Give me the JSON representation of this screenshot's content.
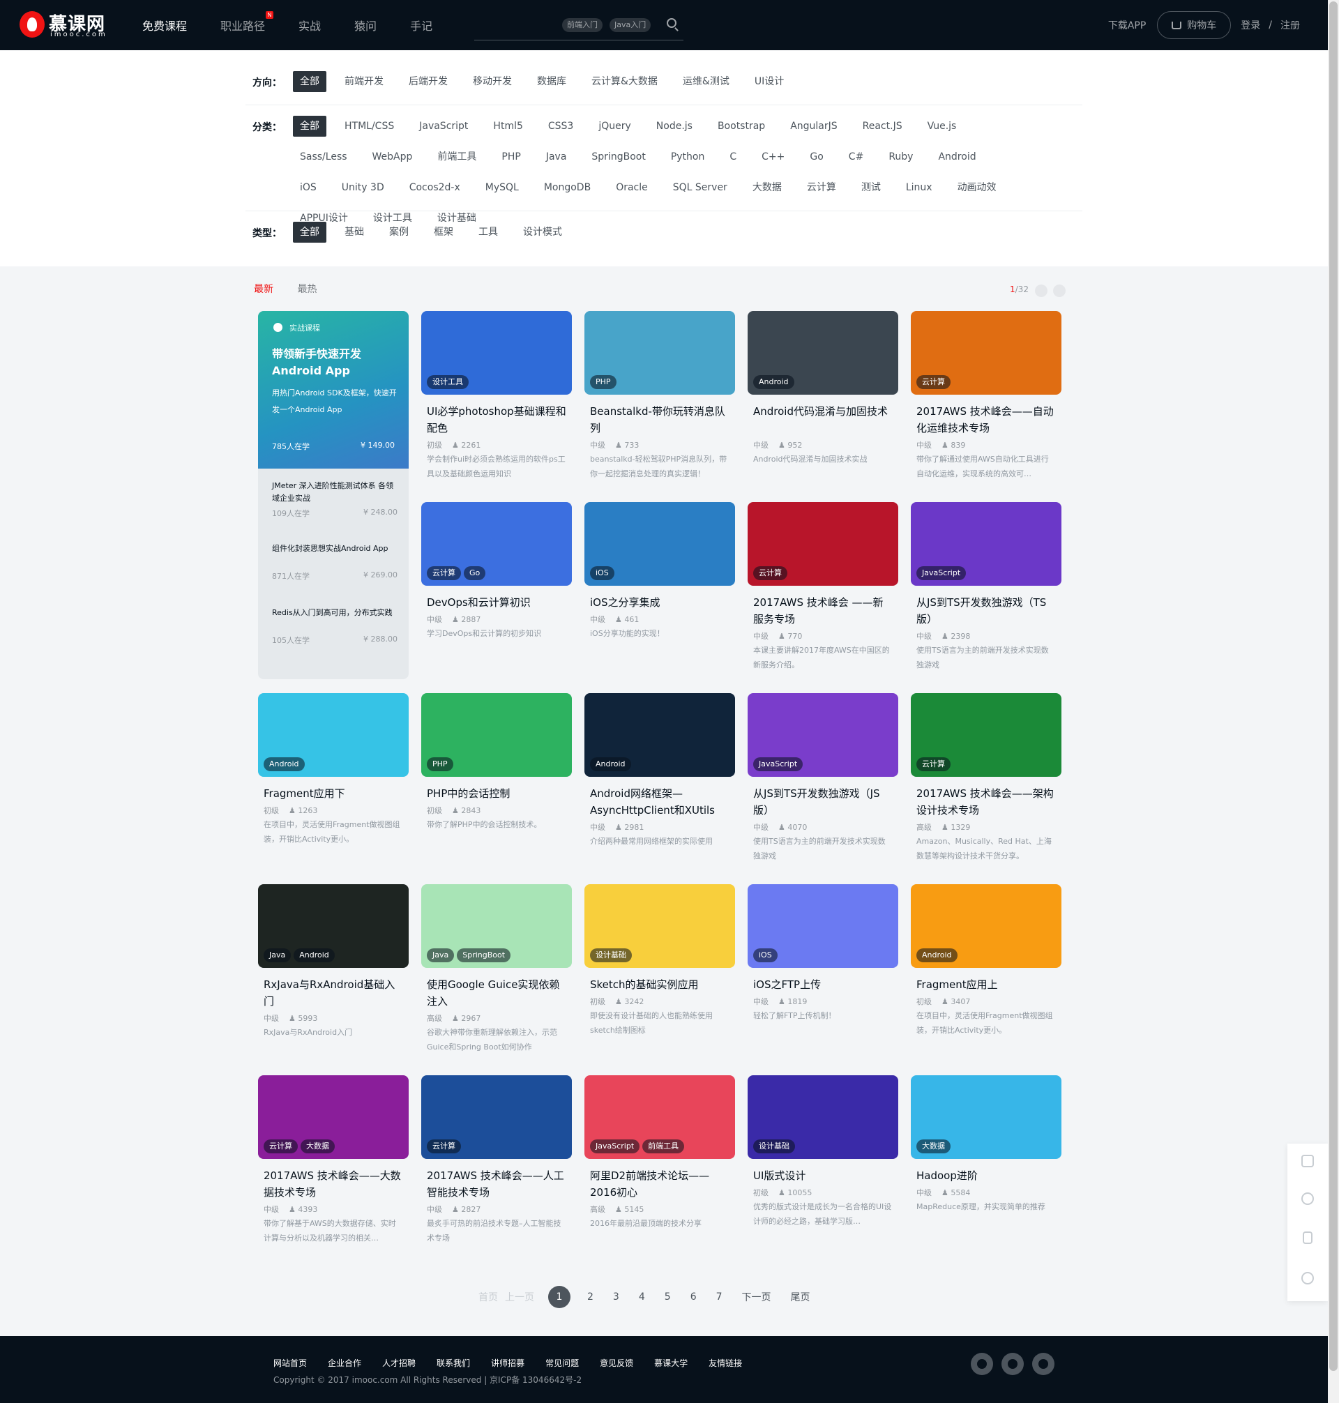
{
  "header": {
    "logo_cn": "慕课网",
    "logo_en": "imooc.com",
    "nav": [
      {
        "label": "免费课程",
        "active": true
      },
      {
        "label": "职业路径",
        "badge": "N"
      },
      {
        "label": "实战"
      },
      {
        "label": "猿问"
      },
      {
        "label": "手记"
      }
    ],
    "search_tags": [
      "前端入门",
      "Java入门"
    ],
    "download": "下载APP",
    "cart": "购物车",
    "login": "登录",
    "sep": "/",
    "register": "注册"
  },
  "filters": {
    "direction": {
      "label": "方向：",
      "items": [
        "全部",
        "前端开发",
        "后端开发",
        "移动开发",
        "数据库",
        "云计算&大数据",
        "运维&测试",
        "UI设计"
      ]
    },
    "category": {
      "label": "分类：",
      "items": [
        "全部",
        "HTML/CSS",
        "JavaScript",
        "Html5",
        "CSS3",
        "jQuery",
        "Node.js",
        "Bootstrap",
        "AngularJS",
        "React.JS",
        "Vue.js",
        "Sass/Less",
        "WebApp",
        "前端工具",
        "PHP",
        "Java",
        "SpringBoot",
        "Python",
        "C",
        "C++",
        "Go",
        "C#",
        "Ruby",
        "Android",
        "iOS",
        "Unity 3D",
        "Cocos2d-x",
        "MySQL",
        "MongoDB",
        "Oracle",
        "SQL Server",
        "大数据",
        "云计算",
        "测试",
        "Linux",
        "动画动效",
        "APPUI设计",
        "设计工具",
        "设计基础"
      ]
    },
    "type": {
      "label": "类型：",
      "items": [
        "全部",
        "基础",
        "案例",
        "框架",
        "工具",
        "设计模式"
      ]
    }
  },
  "sort": {
    "newest": "最新",
    "hottest": "最热"
  },
  "page_info": {
    "current": "1",
    "total": "/32"
  },
  "feature": {
    "tag": "实战课程",
    "title": "带领新手快速开发Android App",
    "desc": "用热门Android SDK及框架，快速开发一个Android App",
    "students": "785人在学",
    "price": "¥ 149.00",
    "list": [
      {
        "title": "JMeter 深入进阶性能测试体系 各领域企业实战",
        "students": "109人在学",
        "price": "¥ 248.00"
      },
      {
        "title": "组件化封装思想实战Android App",
        "students": "871人在学",
        "price": "¥ 269.00"
      },
      {
        "title": "Redis从入门到高可用，分布式实践",
        "students": "105人在学",
        "price": "¥ 288.00"
      }
    ]
  },
  "courses": [
    {
      "title": "UI必学photoshop基础课程和配色",
      "level": "初级",
      "students": "2261",
      "desc": "学会制作ui时必须会熟练运用的软件ps工具以及基础颜色运用知识",
      "tags": [
        "设计工具"
      ],
      "bg": "#2f6bd8"
    },
    {
      "title": "Beanstalkd-带你玩转消息队列",
      "level": "中级",
      "students": "733",
      "desc": "beanstalkd-轻松驾驭PHP消息队列，带你一起挖掘消息处理的真实逻辑！",
      "tags": [
        "PHP"
      ],
      "bg": "#48a4c9"
    },
    {
      "title": "Android代码混淆与加固技术",
      "level": "中级",
      "students": "952",
      "desc": "Android代码混淆与加固技术实战",
      "tags": [
        "Android"
      ],
      "bg": "#3b4650"
    },
    {
      "title": "2017AWS 技术峰会——自动化运维技术专场",
      "level": "中级",
      "students": "839",
      "desc": "带你了解通过使用AWS自动化工具进行自动化运维，实现系统的高效可…",
      "tags": [
        "云计算"
      ],
      "bg": "#e06d12"
    },
    {
      "title": "DevOps和云计算初识",
      "level": "中级",
      "students": "2887",
      "desc": "学习DevOps和云计算的初步知识",
      "tags": [
        "云计算",
        "Go"
      ],
      "bg": "#3c6fe0"
    },
    {
      "title": "iOS之分享集成",
      "level": "中级",
      "students": "461",
      "desc": "iOS分享功能的实现！",
      "tags": [
        "iOS"
      ],
      "bg": "#2a7ec4"
    },
    {
      "title": "2017AWS 技术峰会 ——新服务专场",
      "level": "中级",
      "students": "770",
      "desc": "本课主要讲解2017年度AWS在中国区的新服务介绍。",
      "tags": [
        "云计算"
      ],
      "bg": "#b8152a"
    },
    {
      "title": "从JS到TS开发数独游戏（TS版）",
      "level": "中级",
      "students": "2398",
      "desc": "使用TS语言为主的前端开发技术实现数独游戏",
      "tags": [
        "JavaScript"
      ],
      "bg": "#6b38c8"
    },
    {
      "title": "Fragment应用下",
      "level": "初级",
      "students": "1263",
      "desc": "在项目中，灵活使用Fragment做视图组装，开销比Activity更小。",
      "tags": [
        "Android"
      ],
      "bg": "#36c3e6"
    },
    {
      "title": "PHP中的会话控制",
      "level": "初级",
      "students": "2843",
      "desc": "带你了解PHP中的会话控制技术。",
      "tags": [
        "PHP"
      ],
      "bg": "#2db260"
    },
    {
      "title": "Android网络框架—AsyncHttpClient和XUtils",
      "level": "中级",
      "students": "2981",
      "desc": "介绍两种最常用网络框架的实际使用",
      "tags": [
        "Android"
      ],
      "bg": "#10243a"
    },
    {
      "title": "从JS到TS开发数独游戏（JS版）",
      "level": "中级",
      "students": "4070",
      "desc": "使用TS语言为主的前端开发技术实现数独游戏",
      "tags": [
        "JavaScript"
      ],
      "bg": "#7a3dcb"
    },
    {
      "title": "2017AWS 技术峰会——架构设计技术专场",
      "level": "高级",
      "students": "1329",
      "desc": "Amazon、Musically、Red Hat、上海数慧等架构设计技术干货分享。",
      "tags": [
        "云计算"
      ],
      "bg": "#1b8a38"
    },
    {
      "title": "RxJava与RxAndroid基础入门",
      "level": "中级",
      "students": "5993",
      "desc": "RxJava与RxAndroid入门",
      "tags": [
        "Java",
        "Android"
      ],
      "bg": "#1e2522"
    },
    {
      "title": "使用Google Guice实现依赖注入",
      "level": "高级",
      "students": "2967",
      "desc": "谷歌大神带你重新理解依赖注入，示范Guice和Spring Boot如何协作",
      "tags": [
        "Java",
        "SpringBoot"
      ],
      "bg": "#a8e4b6"
    },
    {
      "title": "Sketch的基础实例应用",
      "level": "初级",
      "students": "3242",
      "desc": "即使没有设计基础的人也能熟练使用sketch绘制图标",
      "tags": [
        "设计基础"
      ],
      "bg": "#f8cf3c"
    },
    {
      "title": "iOS之FTP上传",
      "level": "中级",
      "students": "1819",
      "desc": "轻松了解FTP上传机制！",
      "tags": [
        "iOS"
      ],
      "bg": "#6b7af2"
    },
    {
      "title": "Fragment应用上",
      "level": "初级",
      "students": "3407",
      "desc": "在项目中，灵活使用Fragment做视图组装，开销比Activity更小。",
      "tags": [
        "Android"
      ],
      "bg": "#f89c12"
    },
    {
      "title": "2017AWS 技术峰会——大数据技术专场",
      "level": "中级",
      "students": "4393",
      "desc": "带你了解基于AWS的大数据存储、实时计算与分析以及机器学习的相关…",
      "tags": [
        "云计算",
        "大数据"
      ],
      "bg": "#8a1e9a"
    },
    {
      "title": "2017AWS 技术峰会——人工智能技术专场",
      "level": "中级",
      "students": "2827",
      "desc": "最炙手可热的前沿技术专题–人工智能技术专场",
      "tags": [
        "云计算"
      ],
      "bg": "#1c4e9a"
    },
    {
      "title": "阿里D2前端技术论坛——2016初心",
      "level": "高级",
      "students": "5145",
      "desc": "2016年最前沿最顶端的技术分享",
      "tags": [
        "JavaScript",
        "前端工具"
      ],
      "bg": "#e8455a"
    },
    {
      "title": "UI版式设计",
      "level": "初级",
      "students": "10055",
      "desc": "优秀的版式设计是成长为一名合格的UI设计师的必经之路，基础学习版…",
      "tags": [
        "设计基础"
      ],
      "bg": "#3a2aa8"
    },
    {
      "title": "Hadoop进阶",
      "level": "中级",
      "students": "5584",
      "desc": "MapReduce原理，并实现简单的推荐",
      "tags": [
        "大数据"
      ],
      "bg": "#37b6e8"
    }
  ],
  "pager": {
    "first": "首页",
    "prev": "上一页",
    "pages": [
      "1",
      "2",
      "3",
      "4",
      "5",
      "6",
      "7"
    ],
    "next": "下一页",
    "last": "尾页"
  },
  "footer": {
    "links": [
      "网站首页",
      "企业合作",
      "人才招聘",
      "联系我们",
      "讲师招募",
      "常见问题",
      "意见反馈",
      "慕课大学",
      "友情链接"
    ],
    "copyright": "Copyright © 2017 imooc.com All Rights Reserved | 京ICP备 13046642号-2"
  }
}
